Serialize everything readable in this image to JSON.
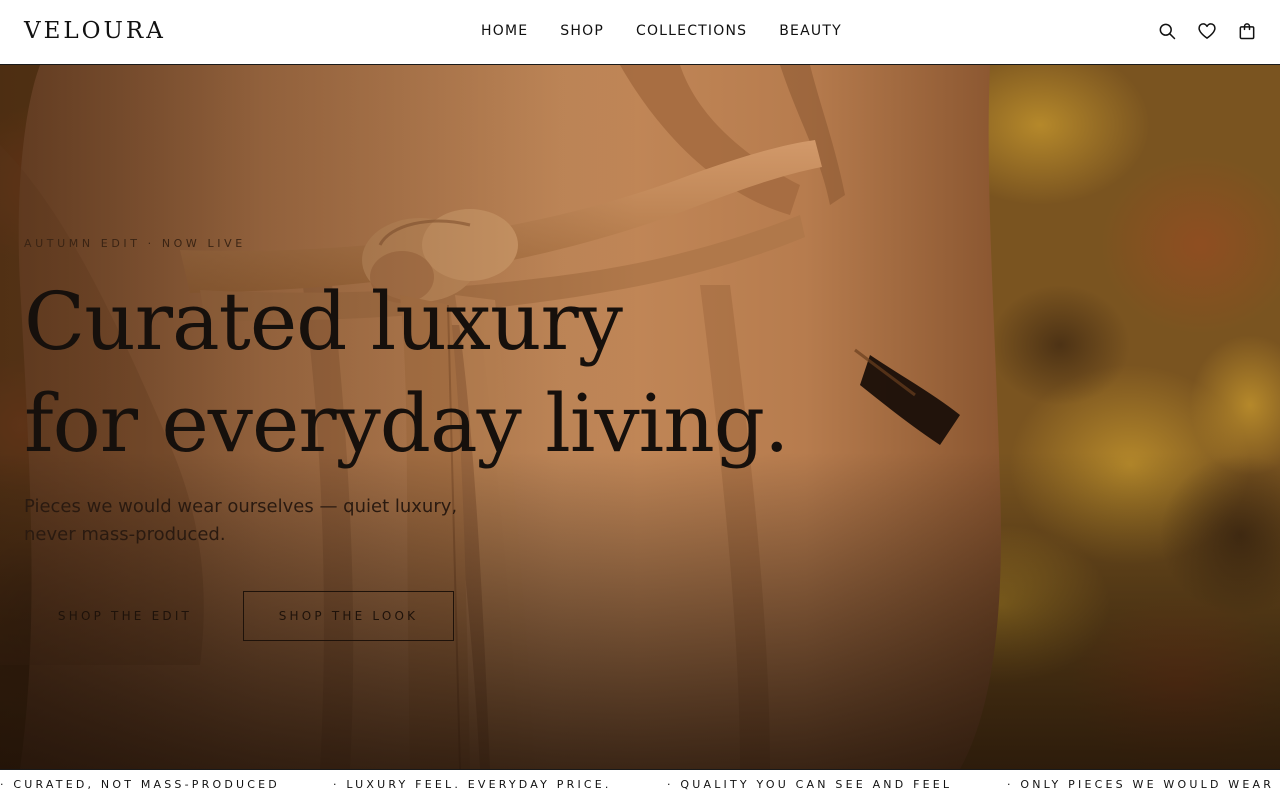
{
  "brand": {
    "logo": "VELOURA"
  },
  "nav": {
    "items": [
      {
        "label": "HOME"
      },
      {
        "label": "SHOP"
      },
      {
        "label": "COLLECTIONS"
      },
      {
        "label": "BEAUTY"
      }
    ]
  },
  "header_icons": [
    "search-icon",
    "heart-icon",
    "shopping-bag-icon"
  ],
  "hero": {
    "eyebrow": "AUTUMN EDIT · NOW LIVE",
    "headline_line1": "Curated luxury",
    "headline_line2": "for everyday living.",
    "subtext": "Pieces we would wear ourselves — quiet luxury, never mass-produced.",
    "primary_cta": "SHOP THE EDIT",
    "secondary_cta": "SHOP THE LOOK"
  },
  "marquee": {
    "items": [
      "· CURATED, NOT MASS-PRODUCED",
      "· LUXURY FEEL. EVERYDAY PRICE.",
      "· QUALITY YOU CAN SEE AND FEEL",
      "· ONLY PIECES WE WOULD WEAR OURSELVES"
    ]
  },
  "colors": {
    "header_bg": "#ffffff",
    "text": "#111111",
    "coat_camel": "#b57a4c",
    "foliage": "#6b4a1e"
  }
}
